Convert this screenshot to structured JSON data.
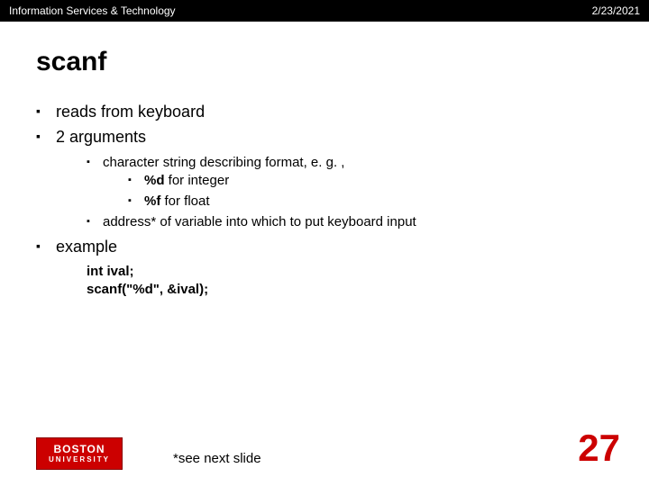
{
  "header": {
    "left": "Information Services & Technology",
    "right": "2/23/2021"
  },
  "title": "scanf",
  "bullets": {
    "b1": "reads from keyboard",
    "b2": "2 arguments",
    "b2_1": "character string describing format, e. g. ,",
    "b2_1_1_bold": "%d",
    "b2_1_1_rest": " for integer",
    "b2_1_2_bold": "%f",
    "b2_1_2_rest": " for float",
    "b2_2": "address* of variable into which to put keyboard input",
    "b3": "example"
  },
  "code": {
    "line1": "int ival;",
    "line2": "scanf(\"%d\", &ival);"
  },
  "footer": {
    "logo_top": "BOSTON",
    "logo_bottom": "UNIVERSITY",
    "note": "*see next slide",
    "page": "27"
  }
}
